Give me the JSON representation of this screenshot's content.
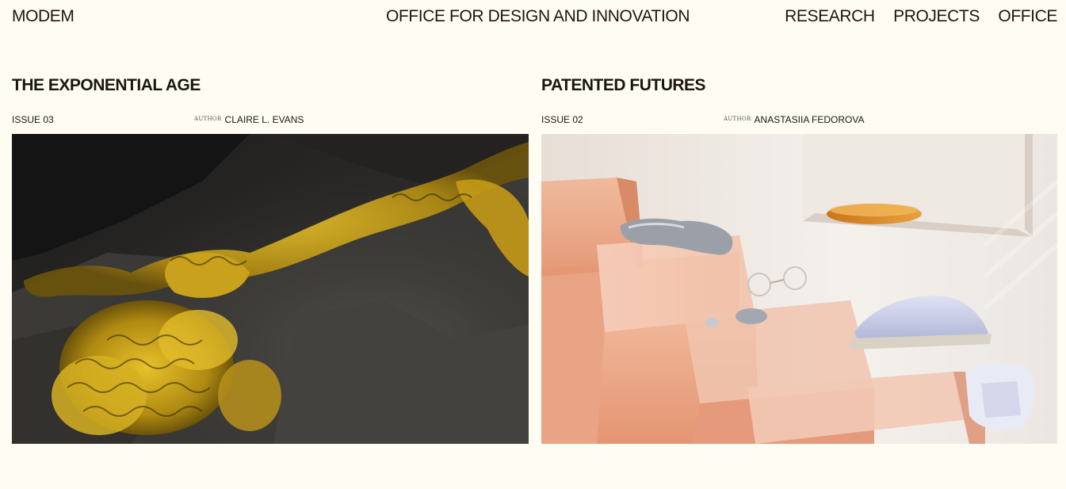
{
  "header": {
    "brand": "MODEM",
    "tagline": "OFFICE FOR DESIGN AND INNOVATION",
    "nav": [
      {
        "label": "RESEARCH"
      },
      {
        "label": "PROJECTS"
      },
      {
        "label": "OFFICE"
      }
    ]
  },
  "articles": [
    {
      "title": "THE EXPONENTIAL AGE",
      "issue": "ISSUE 03",
      "author_label": "AUTHOR",
      "author": "CLAIRE L. EVANS",
      "image": "yellow-lichen-on-dark-rock-photo"
    },
    {
      "title": "PATENTED FUTURES",
      "issue": "ISSUE 02",
      "author_label": "AUTHOR",
      "author": "ANASTASIIA FEDOROVA",
      "image": "objects-on-peach-translucent-steps-photo"
    }
  ],
  "colors": {
    "background": "#fffdf3",
    "text": "#1a1712"
  }
}
